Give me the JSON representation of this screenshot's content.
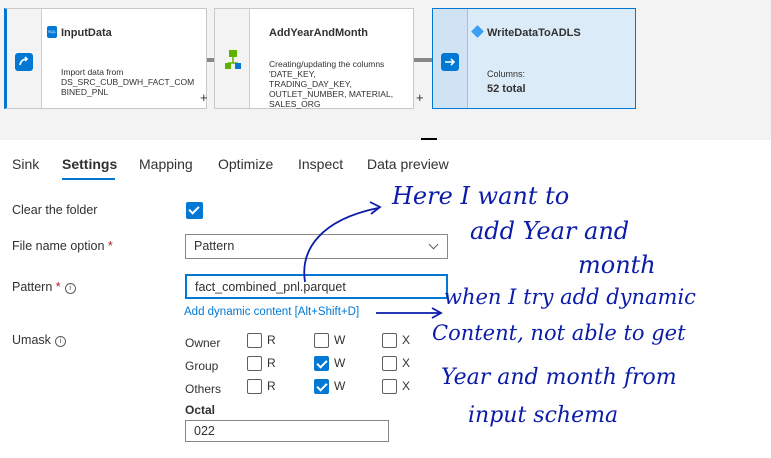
{
  "pipeline": {
    "input_node": {
      "title": "InputData",
      "desc_line1": "Import data from",
      "desc_line2": "DS_SRC_CUB_DWH_FACT_COM",
      "desc_line3": "BINED_PNL",
      "badge": "SQL"
    },
    "derive_node": {
      "title": "AddYearAndMonth",
      "desc_line1": "Creating/updating the columns",
      "desc_line2": "'DATE_KEY,",
      "desc_line3": "TRADING_DAY_KEY,",
      "desc_line4": "OUTLET_NUMBER, MATERIAL,",
      "desc_line5": "SALES_ORG"
    },
    "sink_node": {
      "title": "WriteDataToADLS",
      "columns_label": "Columns:",
      "columns_value": "52 total"
    },
    "plus": "+"
  },
  "tabs": [
    "Sink",
    "Settings",
    "Mapping",
    "Optimize",
    "Inspect",
    "Data preview"
  ],
  "active_tab": "Settings",
  "form": {
    "clear_folder": {
      "label": "Clear the folder",
      "checked": true
    },
    "file_name_option": {
      "label": "File name option",
      "required": "*",
      "value": "Pattern"
    },
    "pattern": {
      "label": "Pattern",
      "required": "*",
      "value": "fact_combined_pnl.parquet",
      "dynamic_link": "Add dynamic content [Alt+Shift+D]"
    },
    "umask": {
      "label": "Umask",
      "rows": [
        {
          "name": "Owner",
          "r": false,
          "w": false,
          "x": false
        },
        {
          "name": "Group",
          "r": false,
          "w": true,
          "x": false
        },
        {
          "name": "Others",
          "r": false,
          "w": true,
          "x": false
        }
      ],
      "r": "R",
      "w": "W",
      "x": "X",
      "octal_label": "Octal",
      "octal_value": "022"
    }
  },
  "annotations": {
    "line1": "Here I want to",
    "line2": "add Year and",
    "line3": "month",
    "line4": "when I try add dynamic",
    "line5": "Content, not able to get",
    "line6": "Year and month from",
    "line7": "input schema"
  },
  "colors": {
    "accent": "#0078d4",
    "ink": "#0a1ca8",
    "selected_node": "#dcebf8"
  }
}
